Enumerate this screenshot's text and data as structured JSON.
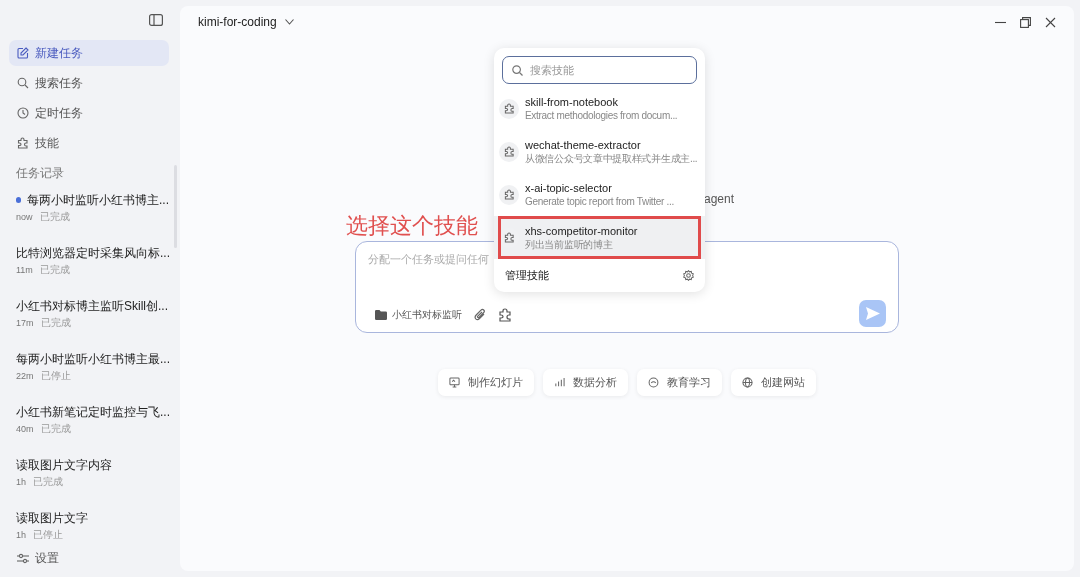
{
  "sidebar": {
    "nav": [
      {
        "label": "新建任务",
        "selected": true
      },
      {
        "label": "搜索任务",
        "selected": false
      },
      {
        "label": "定时任务",
        "selected": false
      },
      {
        "label": "技能",
        "selected": false
      }
    ],
    "history_title": "任务记录",
    "history": [
      {
        "title": "每两小时监听小红书博主...",
        "time": "now",
        "status": "已完成",
        "unread": true
      },
      {
        "title": "比特浏览器定时采集风向标...",
        "time": "11m",
        "status": "已完成",
        "unread": false
      },
      {
        "title": "小红书对标博主监听Skill创...",
        "time": "17m",
        "status": "已完成",
        "unread": false
      },
      {
        "title": "每两小时监听小红书博主最...",
        "time": "22m",
        "status": "已停止",
        "unread": false
      },
      {
        "title": "小红书新笔记定时监控与飞...",
        "time": "40m",
        "status": "已完成",
        "unread": false
      },
      {
        "title": "读取图片文字内容",
        "time": "1h",
        "status": "已完成",
        "unread": false
      },
      {
        "title": "读取图片文字",
        "time": "1h",
        "status": "已停止",
        "unread": false
      }
    ],
    "settings": "设置"
  },
  "header": {
    "model": "kimi-for-coding"
  },
  "hero_fragment": "agent",
  "composer": {
    "placeholder": "分配一个任务或提问任何",
    "folder": "小红书对标监听"
  },
  "skill_menu": {
    "search_placeholder": "搜索技能",
    "skills": [
      {
        "name": "skill-from-notebook",
        "description": "Extract methodologies from docum...",
        "selected": false,
        "annotated": false
      },
      {
        "name": "wechat-theme-extractor",
        "description": "从微信公众号文章中提取样式并生成主...",
        "selected": false,
        "annotated": false
      },
      {
        "name": "x-ai-topic-selector",
        "description": "Generate topic report from Twitter ...",
        "selected": false,
        "annotated": false
      },
      {
        "name": "xhs-competitor-monitor",
        "description": "列出当前监听的博主",
        "selected": true,
        "annotated": true
      }
    ],
    "manage": "管理技能"
  },
  "annotation": {
    "text": "选择这个技能"
  },
  "suggestions": [
    {
      "label": "制作幻灯片"
    },
    {
      "label": "数据分析"
    },
    {
      "label": "教育学习"
    },
    {
      "label": "创建网站"
    }
  ]
}
